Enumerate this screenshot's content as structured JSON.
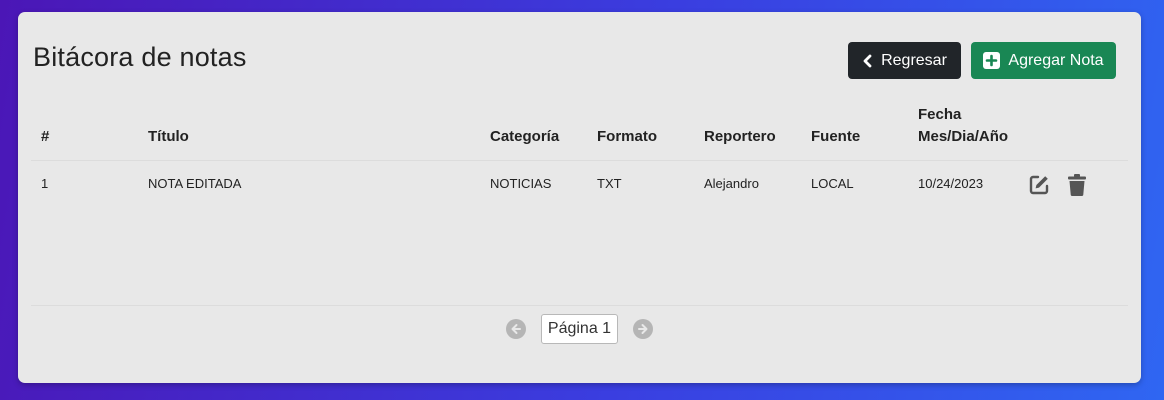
{
  "header": {
    "title": "Bitácora de notas",
    "back_label": "Regresar",
    "add_label": "Agregar Nota"
  },
  "table": {
    "columns": {
      "num": "#",
      "title": "Título",
      "category": "Categoría",
      "format": "Formato",
      "reporter": "Reportero",
      "source": "Fuente",
      "date_line1": "Fecha",
      "date_line2": "Mes/Dia/Año"
    },
    "rows": [
      {
        "num": "1",
        "title": "NOTA EDITADA",
        "category": "NOTICIAS",
        "format": "TXT",
        "reporter": "Alejandro",
        "source": "LOCAL",
        "date": "10/24/2023"
      }
    ]
  },
  "pagination": {
    "label": "Página 1"
  },
  "icons": {
    "back": "chevron-left-icon",
    "add": "plus-square-icon",
    "edit": "edit-icon",
    "delete": "trash-icon",
    "prev": "arrow-left-circle-icon",
    "next": "arrow-right-circle-icon"
  },
  "colors": {
    "back_button": "#212529",
    "add_button": "#198754",
    "card_bg": "#e8e8e8"
  }
}
